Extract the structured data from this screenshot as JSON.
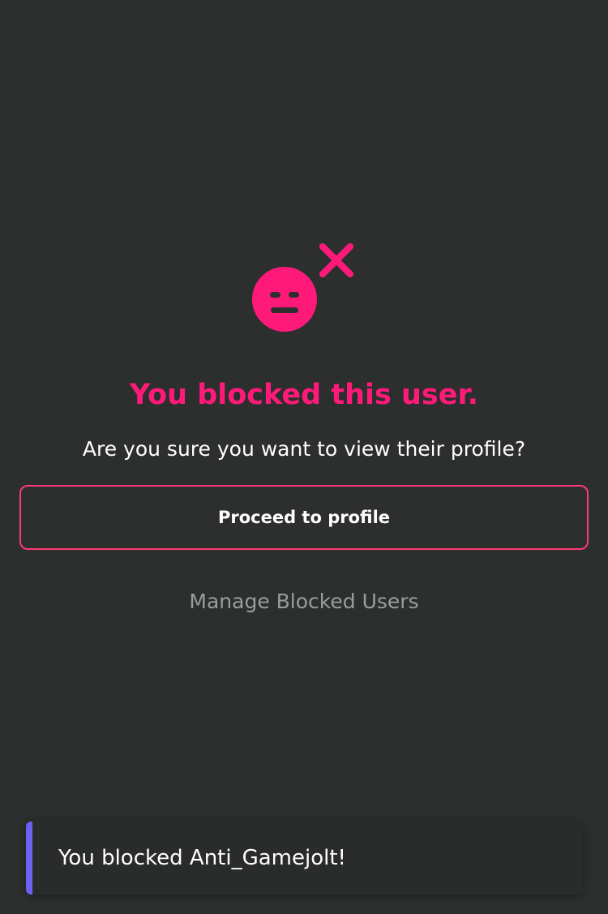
{
  "colors": {
    "background": "#2c2f2d",
    "accent_pink": "#ff1a7a",
    "button_border": "#ff3a74",
    "muted_text": "#9a9d9b",
    "toast_accent": "#6b62f5"
  },
  "icon": {
    "name": "blocked-user-face-icon"
  },
  "blocked_notice": {
    "title": "You blocked this user.",
    "subtitle": "Are you sure you want to view their profile?",
    "proceed_label": "Proceed to profile",
    "manage_label": "Manage Blocked Users"
  },
  "toast": {
    "message": "You blocked Anti_Gamejolt!"
  }
}
